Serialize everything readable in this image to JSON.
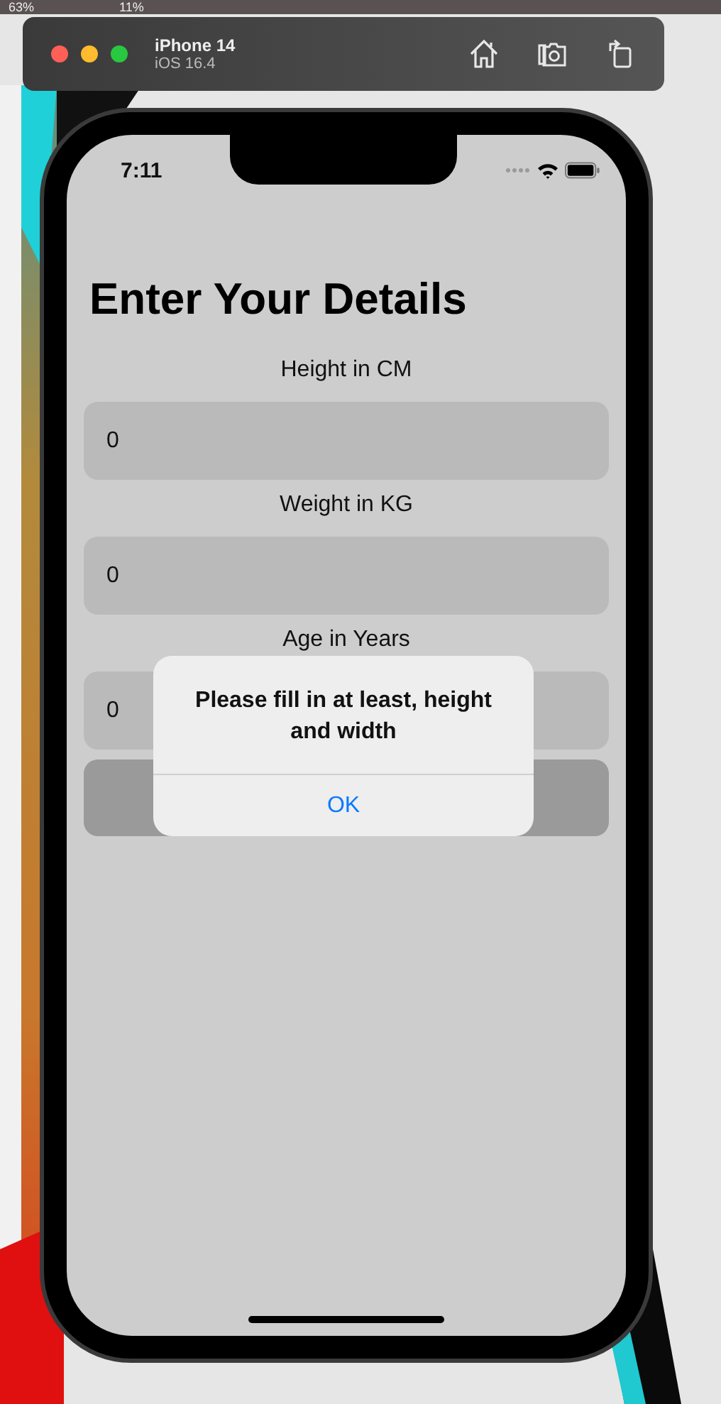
{
  "menu_bar": [
    "63%",
    "11%"
  ],
  "simulator": {
    "device": "iPhone 14",
    "os": "iOS 16.4"
  },
  "status_bar": {
    "time": "7:11"
  },
  "title": "Enter Your Details",
  "fields": [
    {
      "label": "Height in CM",
      "value": "0"
    },
    {
      "label": "Weight in KG",
      "value": "0"
    },
    {
      "label": "Age in Years",
      "value": "0"
    }
  ],
  "alert": {
    "message": "Please fill in at least, height and width",
    "button": "OK"
  }
}
